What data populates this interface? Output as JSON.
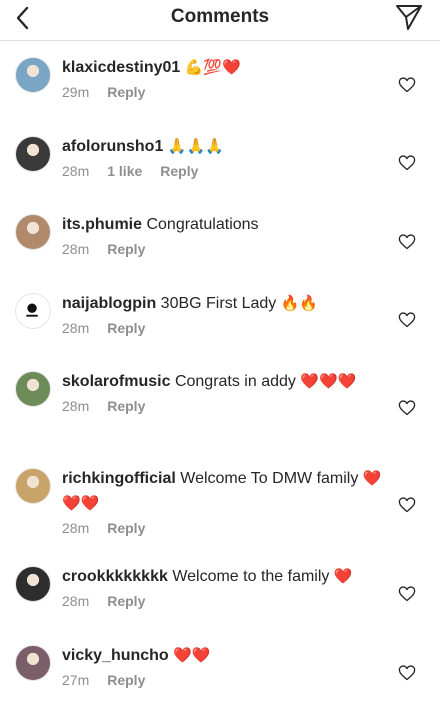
{
  "header": {
    "title": "Comments",
    "back_icon": "chevron-left-icon",
    "share_icon": "paper-plane-icon"
  },
  "comments": [
    {
      "username": "klaxicdestiny01",
      "text": "",
      "emoji": "💪💯❤️",
      "time": "29m",
      "likes": "",
      "reply": "Reply"
    },
    {
      "username": "afolorunsho1",
      "text": "",
      "emoji": "🙏🙏🙏",
      "time": "28m",
      "likes": "1 like",
      "reply": "Reply"
    },
    {
      "username": "its.phumie",
      "text": "Congratulations",
      "emoji": "",
      "time": "28m",
      "likes": "",
      "reply": "Reply"
    },
    {
      "username": "naijablogpin",
      "text": "30BG First Lady",
      "emoji": "🔥🔥",
      "time": "28m",
      "likes": "",
      "reply": "Reply"
    },
    {
      "username": "skolarofmusic",
      "text": "Congrats in addy",
      "emoji": "❤️❤️❤️",
      "time": "28m",
      "likes": "",
      "reply": "Reply"
    },
    {
      "username": "richkingofficial",
      "text": "Welcome To DMW family",
      "emoji": "❤️❤️❤️",
      "time": "28m",
      "likes": "",
      "reply": "Reply"
    },
    {
      "username": "crookkkkkkkk",
      "text": "Welcome to the family",
      "emoji": "❤️",
      "time": "28m",
      "likes": "",
      "reply": "Reply"
    },
    {
      "username": "vicky_huncho",
      "text": "",
      "emoji": "❤️❤️",
      "time": "27m",
      "likes": "",
      "reply": "Reply"
    }
  ],
  "colors": {
    "text": "#262626",
    "meta": "#8e8e8e",
    "divider": "#dbdbdb"
  }
}
